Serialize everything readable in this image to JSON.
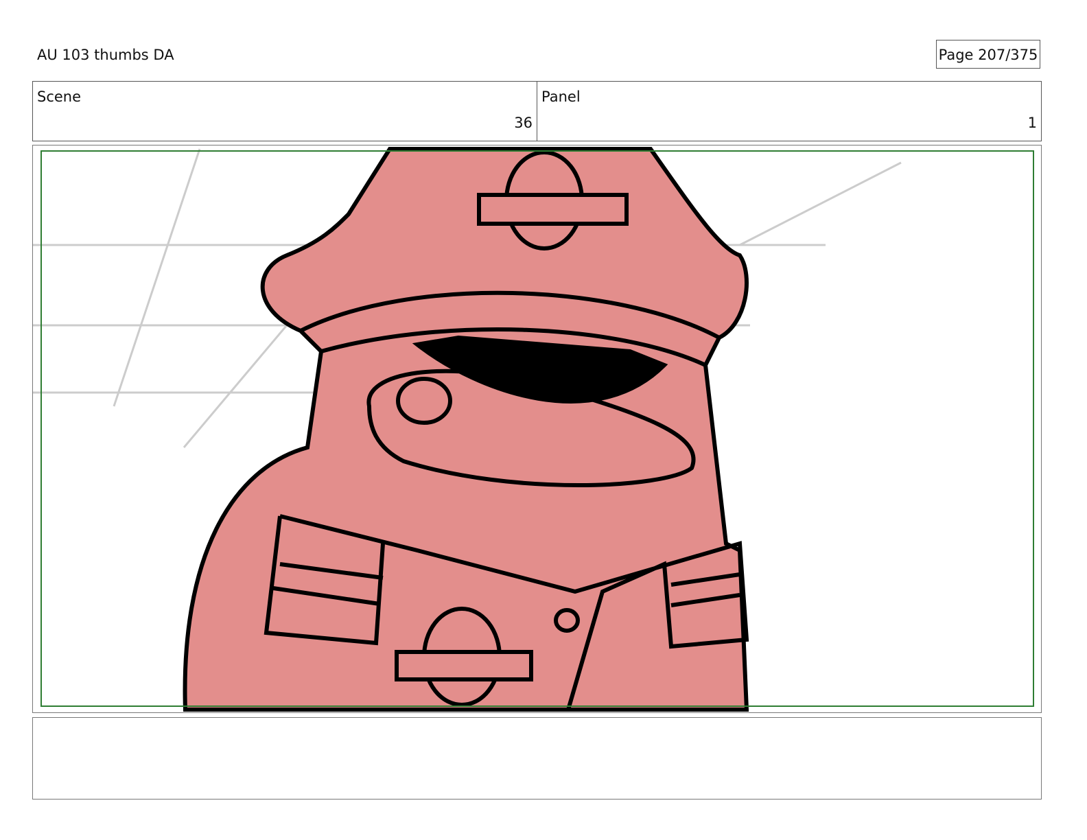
{
  "header": {
    "title": "AU 103 thumbs DA",
    "page": "Page 207/375"
  },
  "scene": {
    "label": "Scene",
    "value": "36"
  },
  "panel": {
    "label": "Panel",
    "value": "1"
  },
  "colors": {
    "character": "#e38e8c",
    "frame": "#2e7d32"
  }
}
